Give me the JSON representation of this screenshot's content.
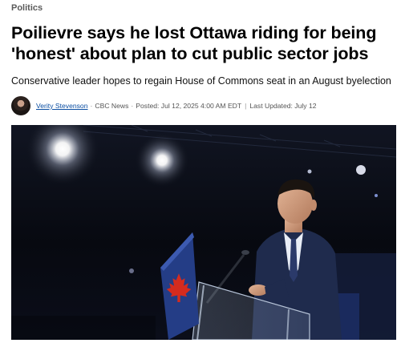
{
  "article": {
    "section": "Politics",
    "headline": "Poilievre says he lost Ottawa riding for being 'honest' about plan to cut public sector jobs",
    "deck": "Conservative leader hopes to regain House of Commons seat in an August byelection",
    "byline": {
      "author": "Verity Stevenson",
      "outlet": "CBC News",
      "posted": "Posted: Jul 12, 2025 4:00 AM EDT",
      "updated": "Last Updated: July 12"
    },
    "hero_image": {
      "subject": "speaker-at-lectern-with-maple-leaf-sign"
    }
  },
  "colors": {
    "link": "#0b4ea2",
    "maple_leaf": "#d52b1e",
    "stage_background": "#0a0d16",
    "suit": "#1f2b4d"
  }
}
